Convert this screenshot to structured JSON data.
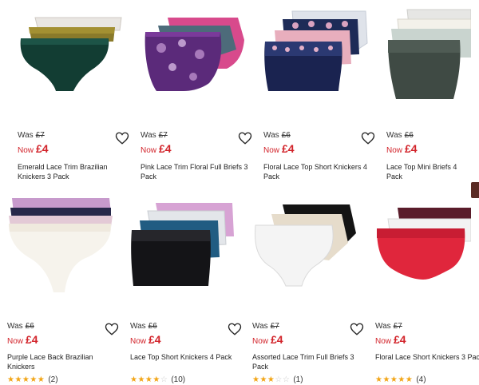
{
  "products": [
    {
      "title": "Emerald Lace Trim Brazilian Knickers 3 Pack",
      "was_label": "Was",
      "was_price": "£7",
      "now_label": "Now",
      "now_price": "£4",
      "image": "emerald-knickers-image"
    },
    {
      "title": "Pink Lace Trim Floral Full Briefs 3 Pack",
      "was_label": "Was",
      "was_price": "£7",
      "now_label": "Now",
      "now_price": "£4",
      "image": "pink-floral-briefs-image"
    },
    {
      "title": "Floral Lace Top Short Knickers 4 Pack",
      "was_label": "Was",
      "was_price": "£6",
      "now_label": "Now",
      "now_price": "£4",
      "image": "floral-short-knickers-image"
    },
    {
      "title": "Lace Top Mini Briefs 4 Pack",
      "was_label": "Was",
      "was_price": "£6",
      "now_label": "Now",
      "now_price": "£4",
      "image": "lace-top-mini-briefs-image"
    },
    {
      "title": "Purple Lace Back Brazilian Knickers",
      "was_label": "Was",
      "was_price": "£6",
      "now_label": "Now",
      "now_price": "£4",
      "rating": 5,
      "review_count": "(2)",
      "image": "purple-brazilian-image"
    },
    {
      "title": "Lace Top Short Knickers 4 Pack",
      "was_label": "Was",
      "was_price": "£6",
      "now_label": "Now",
      "now_price": "£4",
      "rating": 4,
      "review_count": "(10)",
      "image": "lace-top-short-image"
    },
    {
      "title": "Assorted Lace Trim Full Briefs 3 Pack",
      "was_label": "Was",
      "was_price": "£7",
      "now_label": "Now",
      "now_price": "£4",
      "rating": 3,
      "review_count": "(1)",
      "image": "assorted-full-briefs-image"
    },
    {
      "title": "Floral Lace Short Knickers 3 Pac",
      "was_label": "Was",
      "was_price": "£7",
      "now_label": "Now",
      "now_price": "£4",
      "rating": 5,
      "review_count": "(4)",
      "image": "floral-lace-short-image"
    }
  ],
  "colors": {
    "sale_red": "#d2232a",
    "star": "#f2a516",
    "star_empty": "#c9c9c9"
  }
}
